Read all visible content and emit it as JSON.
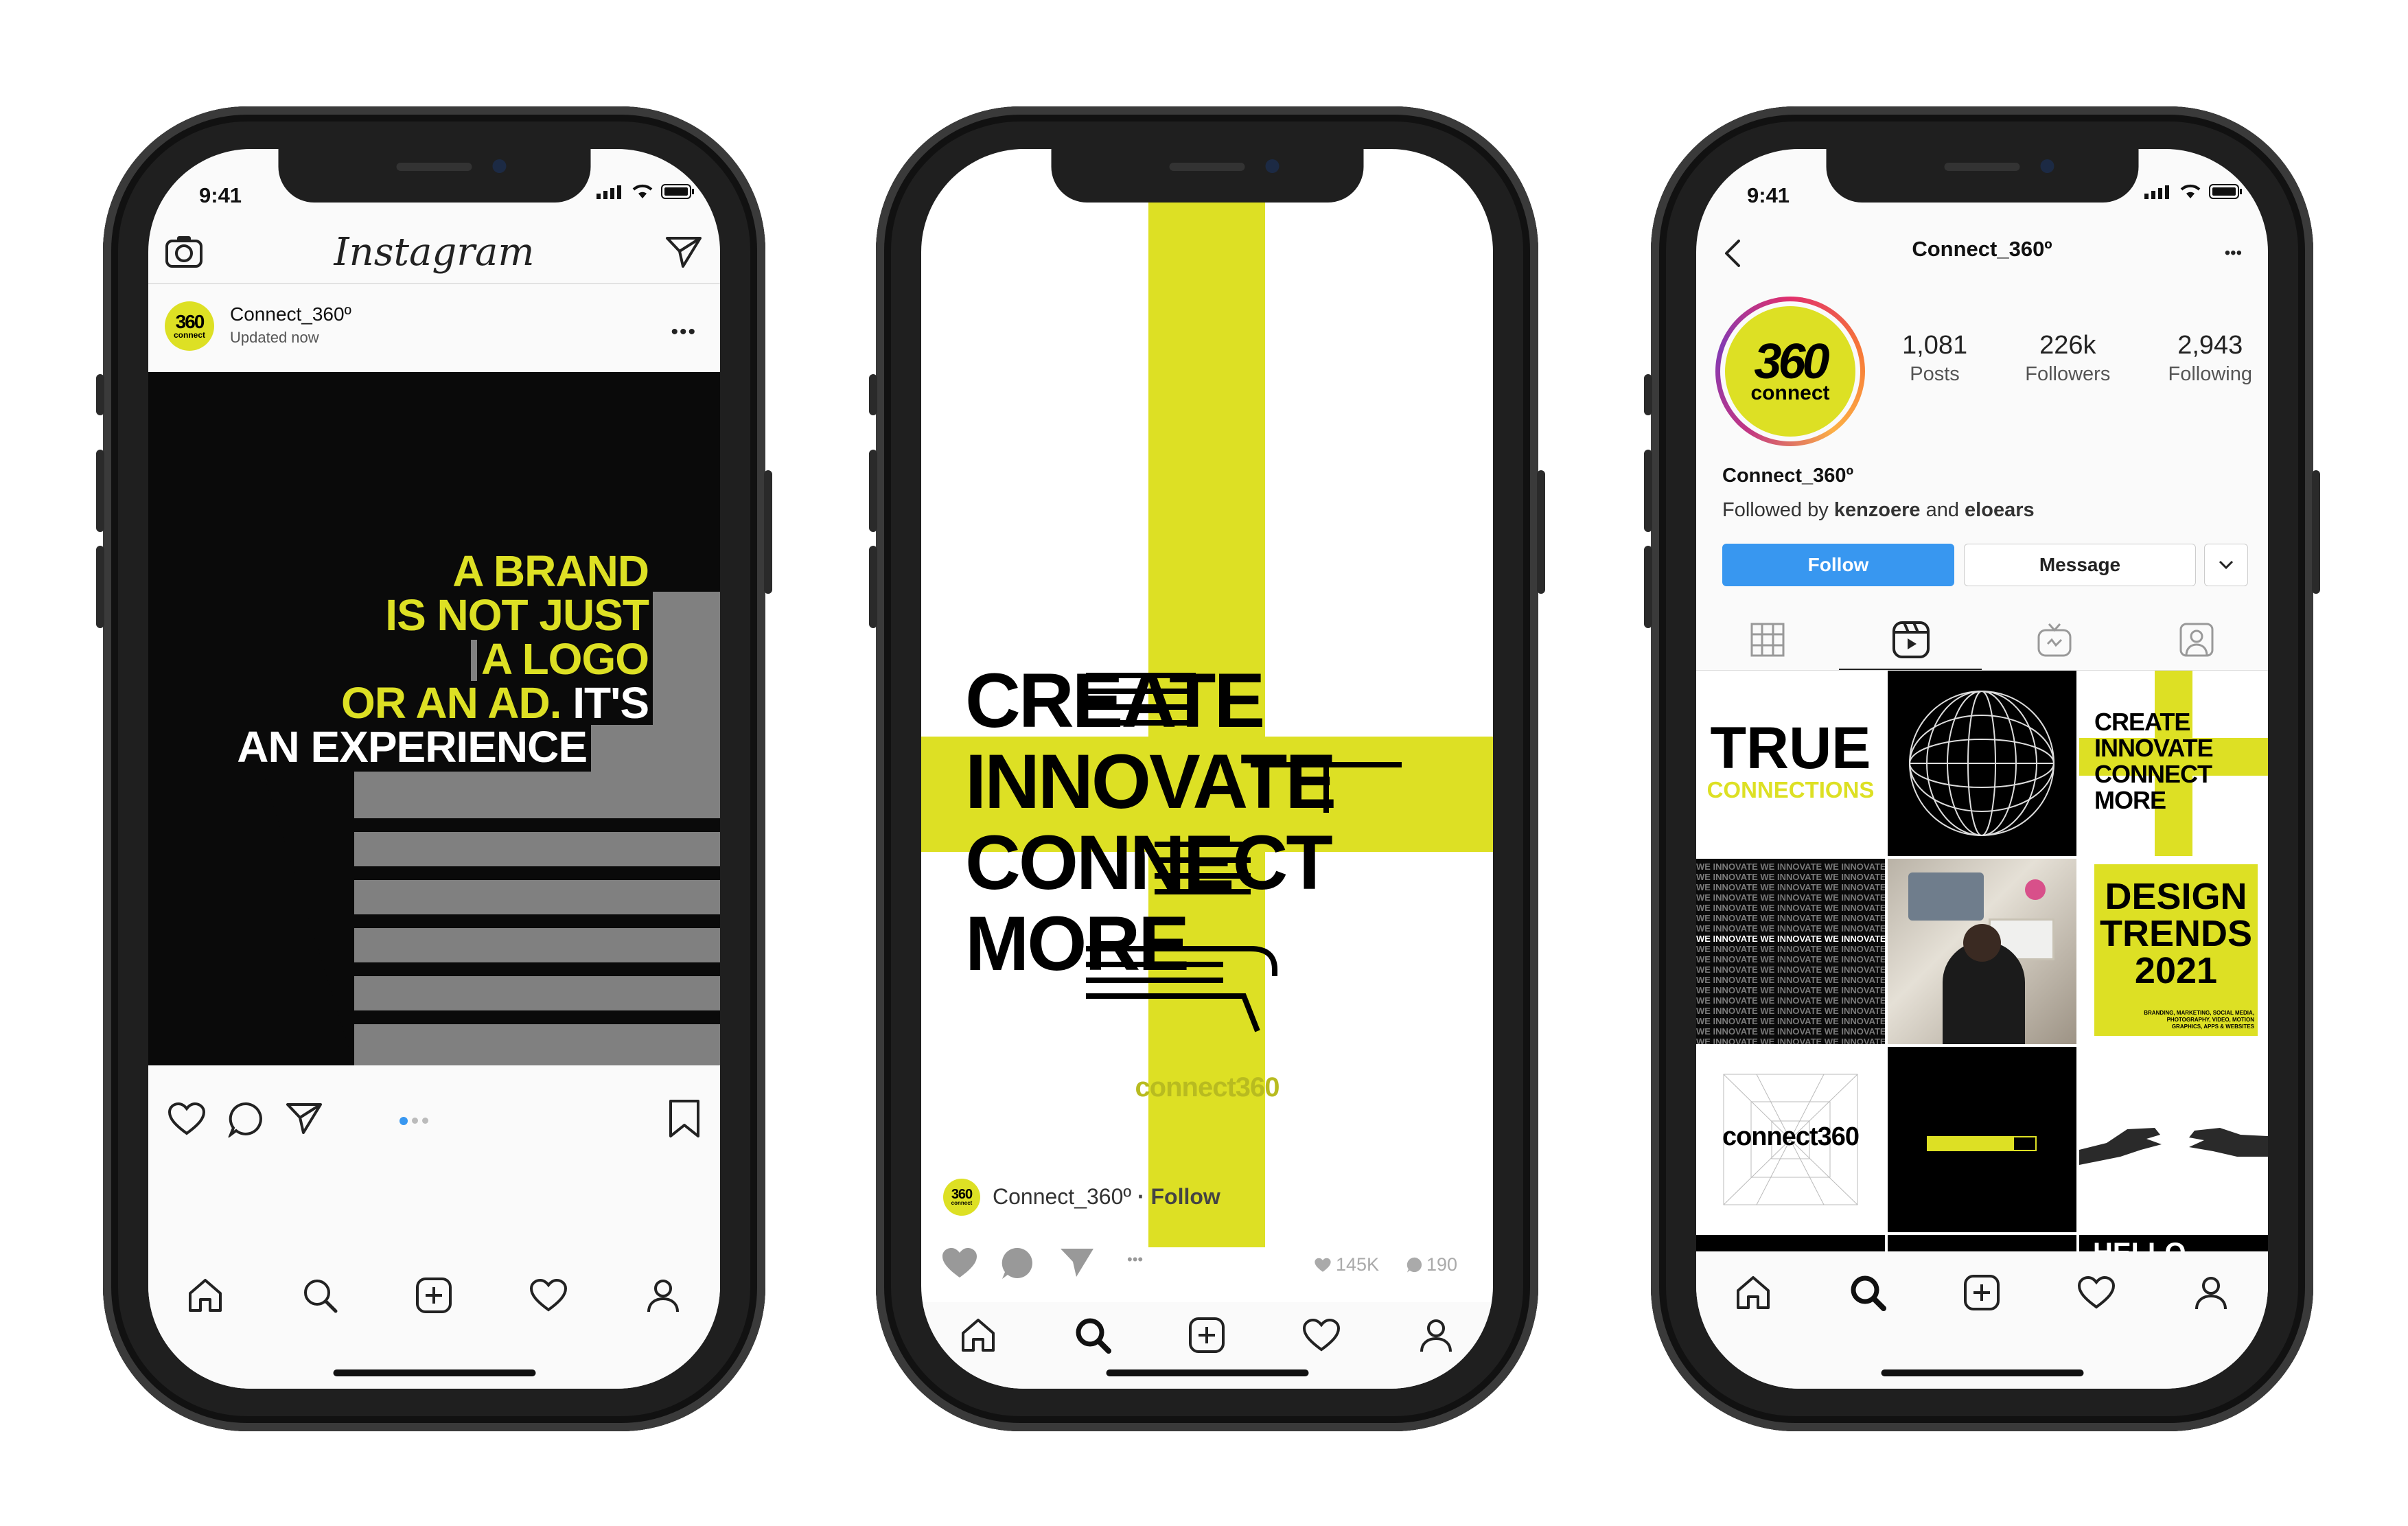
{
  "status": {
    "time": "9:41"
  },
  "phone1": {
    "app_title": "Instagram",
    "account_name": "Connect_360º",
    "account_sub": "Updated now",
    "logo_top": "360",
    "logo_bottom": "connect",
    "poster_lines": [
      {
        "hl": "A BRAND",
        "w": ""
      },
      {
        "hl": "IS NOT JUST",
        "w": ""
      },
      {
        "hl": "A LOGO",
        "w": ""
      },
      {
        "hl": "OR AN AD.",
        "w": " IT'S"
      },
      {
        "hl": "",
        "w": "AN EXPERIENCE"
      }
    ]
  },
  "phone2": {
    "words": [
      "CREATE",
      "INNOVATE",
      "CONNECT",
      "MORE"
    ],
    "watermark": "connect360",
    "account_name": "Connect_360º",
    "follow_text": "· Follow",
    "likes": "145K",
    "comments": "190"
  },
  "phone3": {
    "header_title": "Connect_360º",
    "stats": [
      {
        "value": "1,081",
        "label": "Posts"
      },
      {
        "value": "226k",
        "label": "Followers"
      },
      {
        "value": "2,943",
        "label": "Following"
      }
    ],
    "profile_name": "Connect_360º",
    "followed_prefix": "Followed by ",
    "followed_user1": "kenzoere",
    "followed_and": " and ",
    "followed_user2": "eloears",
    "follow_button": "Follow",
    "message_button": "Message",
    "grid": {
      "true_title": "TRUE",
      "true_sub": "CONNECTIONS",
      "mini_words": [
        "CREATE",
        "INNOVATE",
        "CONNECT",
        "MORE"
      ],
      "innovate_pattern": "WE INNOVATE",
      "design_title": "DESIGN TRENDS 2021",
      "design_sub": "BRANDING, MARKETING, SOCIAL MEDIA, PHOTOGRAPHY, VIDEO, MOTION GRAPHICS, APPS & WEBSITES",
      "connect_logo": "connect360",
      "hello": "HELLO"
    }
  },
  "colors": {
    "accent": "#dde024",
    "dark": "#0a0a0a",
    "shadow": "#808080",
    "follow_blue": "#3897f0"
  }
}
